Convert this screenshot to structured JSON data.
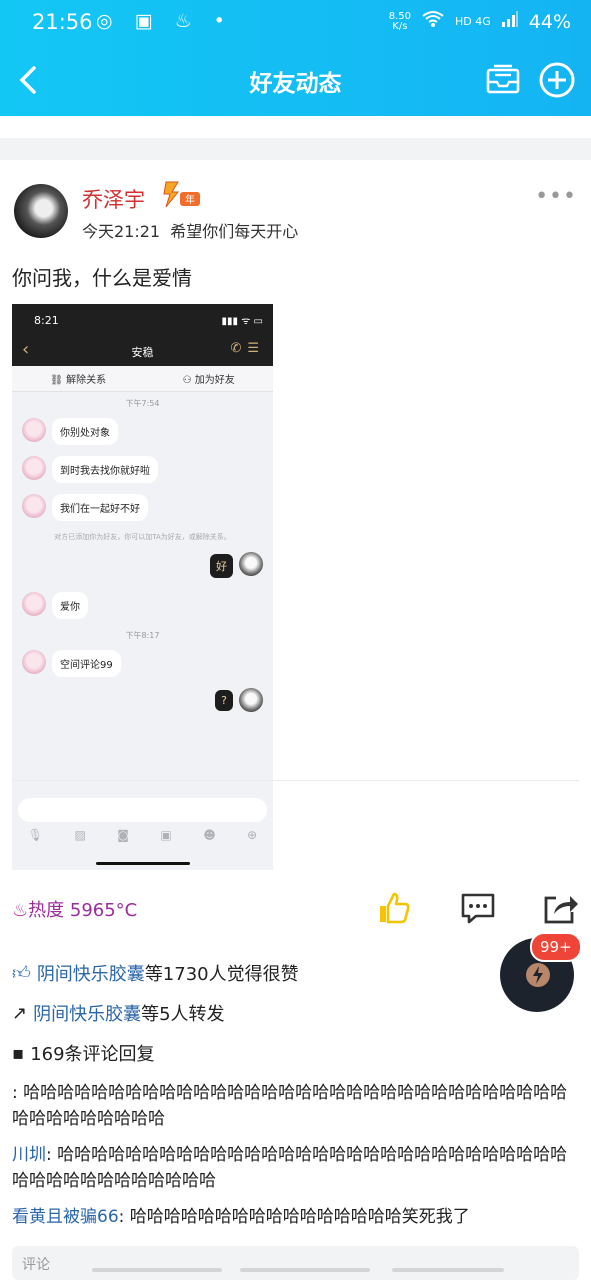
{
  "status_bar": {
    "time": "21:56",
    "speed_top": "8.50",
    "speed_unit": "K/s",
    "network": "HD 4G",
    "battery": "44%"
  },
  "nav": {
    "title": "好友动态"
  },
  "post": {
    "author": "乔泽宇",
    "vip_badge": "年",
    "time": "今天21:21",
    "signature": "希望你们每天开心",
    "text": "你问我，什么是爱情",
    "screenshot": {
      "time": "8:21",
      "contact": "安稳",
      "action_left": "解除关系",
      "action_right": "加为好友",
      "timestamp1": "下午7:54",
      "msg1": "你别处对象",
      "msg2": "到时我去找你就好啦",
      "msg3": "我们在一起好不好",
      "system_note": "对方已添加你为好友，你可以加TA为好友，或解除关系。",
      "reply1": "好",
      "msg4": "爱你",
      "timestamp2": "下午8:17",
      "msg5": "空间评论99",
      "reply2": "?"
    },
    "heat_label": "热度 5965°C"
  },
  "stats": {
    "likes_user": "阴间快乐胶囊",
    "likes_text": "等1730人觉得很赞",
    "shares_user": "阴间快乐胶囊",
    "shares_text": "等5人转发",
    "comments_text": "169条评论回复"
  },
  "comments": [
    {
      "user": "",
      "text": ": 哈哈哈哈哈哈哈哈哈哈哈哈哈哈哈哈哈哈哈哈哈哈哈哈哈哈哈哈哈哈哈哈哈哈哈哈哈哈哈哈哈"
    },
    {
      "user": "川圳",
      "text": ": 哈哈哈哈哈哈哈哈哈哈哈哈哈哈哈哈哈哈哈哈哈哈哈哈哈哈哈哈哈哈哈哈哈哈哈哈哈哈哈哈哈哈"
    },
    {
      "user": "看黄且被骗66",
      "text": ": 哈哈哈哈哈哈哈哈哈哈哈哈哈哈哈哈笑死我了"
    }
  ],
  "fab": {
    "badge": "99+"
  },
  "input_placeholder": "评论"
}
